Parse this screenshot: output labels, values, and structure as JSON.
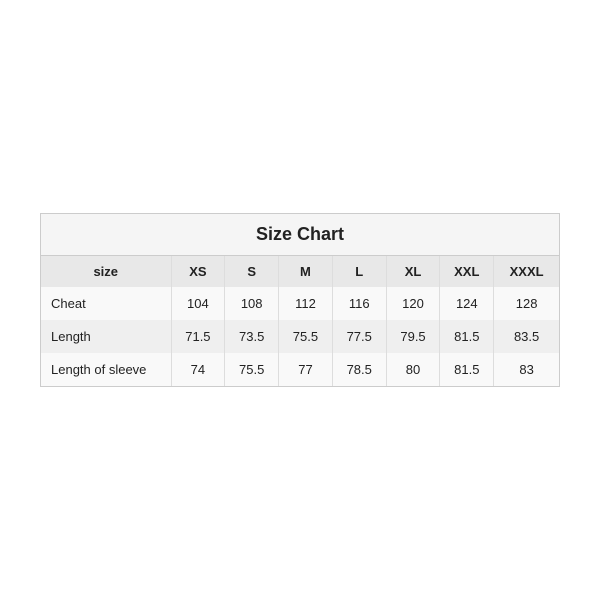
{
  "chart": {
    "title": "Size Chart",
    "columns": [
      "size",
      "XS",
      "S",
      "M",
      "L",
      "XL",
      "XXL",
      "XXXL"
    ],
    "rows": [
      {
        "label": "Cheat",
        "values": [
          "104",
          "108",
          "112",
          "116",
          "120",
          "124",
          "128"
        ]
      },
      {
        "label": "Length",
        "values": [
          "71.5",
          "73.5",
          "75.5",
          "77.5",
          "79.5",
          "81.5",
          "83.5"
        ]
      },
      {
        "label": "Length of sleeve",
        "values": [
          "74",
          "75.5",
          "77",
          "78.5",
          "80",
          "81.5",
          "83"
        ]
      }
    ]
  }
}
